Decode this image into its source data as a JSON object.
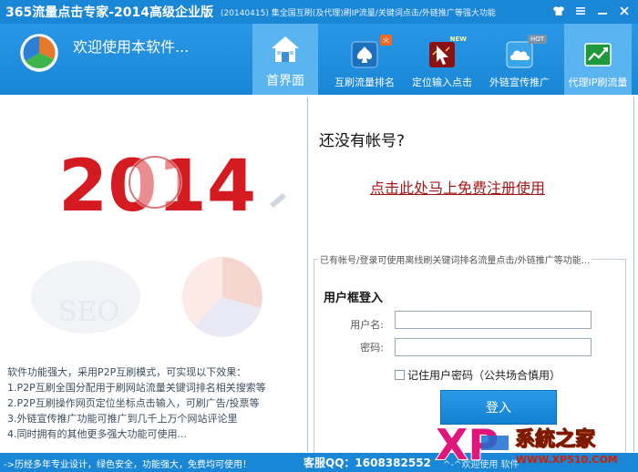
{
  "window": {
    "title": "365流量点击专家-2014高级企业版",
    "subtitle": "(20140415) 集全国互刷(及代理)刷IP流量/关键词点击/外链推广等强大功能",
    "controls": [
      "shirt-icon",
      "menu-icon",
      "minimize-icon",
      "close-icon"
    ]
  },
  "header": {
    "welcome": "欢迎使用本软件...",
    "nav": [
      {
        "label": "首界面",
        "icon": "home-icon",
        "active": true
      },
      {
        "label": "互刷流量排名",
        "icon": "spade-icon",
        "badge": "火"
      },
      {
        "label": "定位输入点击",
        "icon": "cursor-icon",
        "badge": "NEW"
      },
      {
        "label": "外链宣传推广",
        "icon": "cloud-icon",
        "badge": "HOT"
      },
      {
        "label": "代理IP刷流量",
        "icon": "chart-icon",
        "active": true
      }
    ]
  },
  "left": {
    "year": "2014",
    "features": [
      "软件功能强大，采用P2P互刷模式，可实现以下效果：",
      "1.P2P互刷全国分配用于刷网站流量关键词排名相关搜索等",
      "2.P2P互刷操作网页定位坐标点击输入，可刷广告/投票等",
      "3.外链宣传推广功能可推广到几千上万个网站评论里",
      "4.同时拥有的其他更多强大功能可使用..."
    ]
  },
  "right": {
    "no_account": "还没有帐号?",
    "register_link": "点击此处马上免费注册使用",
    "login_caption": "已有帐号/登录可使用离线刷关键词排名流量点击/外链推广等功能...",
    "login_title": "用户框登入",
    "username_label": "用户名:",
    "password_label": "密码:",
    "remember_label": "记住用户密码（公共场合慎用）",
    "login_button": "登入"
  },
  "status": {
    "left": "->历经多年专业设计，绿色安全，功能强大，免费均可使用！",
    "qq": "客服QQ：1608382552",
    "tail": "^-^欢迎使用  软件"
  },
  "watermark": {
    "brand_latin": "XP",
    "brand_cn": "系統之家",
    "url": "WWW.XP510.COM"
  },
  "colors": {
    "primary": "#1a86d6",
    "active_tab": "#5ab4f0",
    "link": "#a41818",
    "year_red": "#d51b22"
  }
}
